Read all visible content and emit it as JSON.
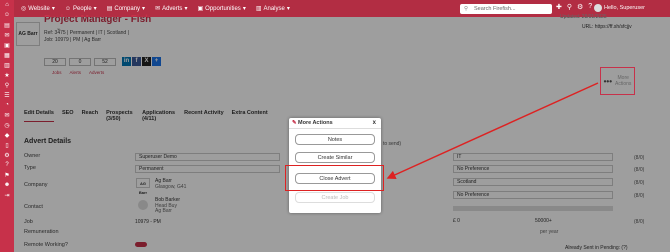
{
  "topbar": {
    "nav": [
      {
        "label": "Website",
        "icon": "globe-icon"
      },
      {
        "label": "People",
        "icon": "person-icon"
      },
      {
        "label": "Company",
        "icon": "building-icon"
      },
      {
        "label": "Adverts",
        "icon": "megaphone-icon"
      },
      {
        "label": "Opportunities",
        "icon": "briefcase-icon"
      },
      {
        "label": "Analyse",
        "icon": "chart-icon"
      }
    ],
    "search_placeholder": "Search Firefish...",
    "user_label": "Hello, Superuser"
  },
  "job": {
    "logo_text": "AG Barr",
    "title": "Project Manager - Fish",
    "meta_line1": "Ref: 3475 | Permanent | IT | Scotland |",
    "meta_line2": "Job: 10979 | PM | Ag Barr",
    "counters": [
      "20",
      "0",
      "52"
    ],
    "small_links": [
      "Jobs",
      "Alerts",
      "Adverts"
    ],
    "updated": "Updated: 28/01/2025",
    "url": "URL: https://ff.sh/sfcjjv"
  },
  "more_actions_button": {
    "label1": "More",
    "label2": "Actions"
  },
  "tabs": [
    "Edit Details",
    "SEO",
    "Reach",
    "Prospects (3/50)",
    "Applications (4/11)",
    "Recent Activity",
    "Extra Content"
  ],
  "form": {
    "section_title": "Advert Details",
    "owner_label": "Owner",
    "owner_value": "Superuser Demo",
    "type_label": "Type",
    "type_value": "Permanent",
    "company_label": "Company",
    "company_value": "Ag Barr",
    "company_sub": "Glasgow, G41",
    "contact_label": "Contact",
    "contact_value": "Bob Barker",
    "contact_sub1": "Head Buy",
    "contact_sub2": "Ag Barr",
    "job_label": "Job",
    "job_value": "10979 - PM",
    "remuneration_label": "Remuneration",
    "remote_label": "Remote Working?",
    "right_value1": "IT",
    "right_value2": "No Preference",
    "right_value3": "Scotland",
    "right_value4": "No Preference",
    "salary_from": "0",
    "salary_to": "50000+",
    "per_year": "per year",
    "to_send": "to send)",
    "counts": [
      "(8/0)",
      "(8/0)",
      "(8/0)",
      "(8/0)",
      "(8/0)"
    ],
    "footer_note": "Already Sent in Pending: (?)"
  },
  "modal": {
    "title": "More Actions",
    "close": "x",
    "buttons": [
      "Notes",
      "Create Similar",
      "Close Advert",
      "Create Job"
    ]
  },
  "colors": {
    "brand": "#c7314a",
    "highlight": "#dd2222"
  }
}
